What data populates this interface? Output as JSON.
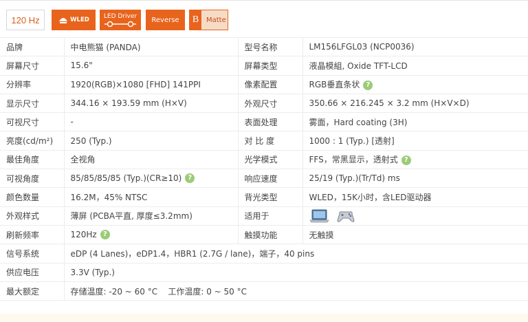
{
  "badges": {
    "hz": "120 Hz",
    "wled": "WLED",
    "led_driver": "LED Driver",
    "reverse": "Reverse",
    "matte_mark": "B",
    "matte": "Matte"
  },
  "rows": [
    {
      "l1": "品牌",
      "v1": "中电熊猫 (PANDA)",
      "l2": "型号名称",
      "v2": "LM156LFGL03 (NCP0036)"
    },
    {
      "l1": "屏幕尺寸",
      "v1": "15.6\"",
      "l2": "屏幕类型",
      "v2": "液晶模組, Oxide TFT-LCD"
    },
    {
      "l1": "分辨率",
      "v1": "1920(RGB)×1080 [FHD] 141PPI",
      "l2": "像素配置",
      "v2": "RGB垂直条状"
    },
    {
      "l1": "显示尺寸",
      "v1": "344.16 × 193.59 mm (H×V)",
      "l2": "外观尺寸",
      "v2": "350.66 × 216.245 × 3.2 mm (H×V×D)"
    },
    {
      "l1": "可视尺寸",
      "v1": "-",
      "l2": "表面处理",
      "v2": "雾面，Hard coating (3H)"
    },
    {
      "l1": "亮度(cd/m²)",
      "v1": "250 (Typ.)",
      "l2": "对 比 度",
      "v2": "1000 : 1 (Typ.) [透射]"
    },
    {
      "l1": "最佳角度",
      "v1": "全视角",
      "l2": "光学模式",
      "v2": "FFS，常黑显示，透射式"
    },
    {
      "l1": "可视角度",
      "v1": "85/85/85/85 (Typ.)(CR≥10)",
      "l2": "响应速度",
      "v2": "25/19 (Typ.)(Tr/Td) ms"
    },
    {
      "l1": "颜色数量",
      "v1": "16.2M，45% NTSC",
      "l2": "背光类型",
      "v2": "WLED，15K小时，含LED驱动器"
    },
    {
      "l1": "外观样式",
      "v1": "薄屏 (PCBA平直, 厚度≤3.2mm)",
      "l2": "适用于",
      "v2": ""
    },
    {
      "l1": "刷新频率",
      "v1": "120Hz",
      "l2": "触摸功能",
      "v2": "无触摸"
    },
    {
      "l1": "信号系统",
      "v1": "eDP (4 Lanes)，eDP1.4，HBR1 (2.7G / lane)，端子，40 pins"
    },
    {
      "l1": "供应电压",
      "v1": "3.3V (Typ.)"
    },
    {
      "l1": "最大额定",
      "v1": "存储温度: -20 ~ 60 °C    工作温度: 0 ~ 50 °C"
    }
  ],
  "help_icon": "?",
  "icons": {
    "help": "question-circle-icon",
    "laptop": "laptop-icon",
    "gamepad": "gamepad-icon"
  }
}
